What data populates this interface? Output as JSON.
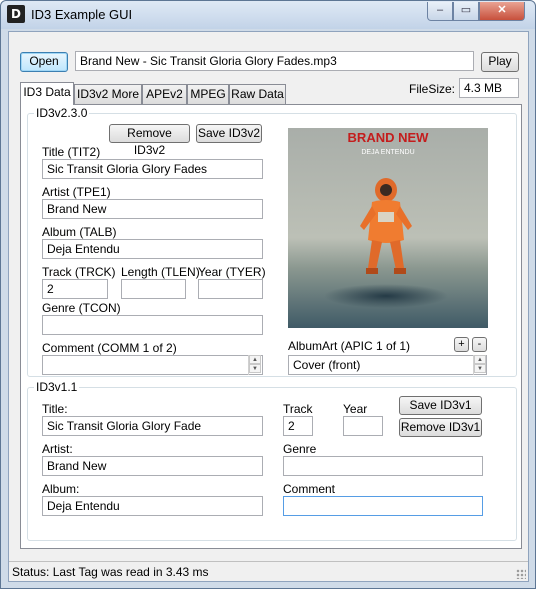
{
  "window": {
    "title": "ID3 Example GUI",
    "icon_text": "D",
    "controls": {
      "minimize": "‒",
      "maximize": "▭",
      "close": "✕"
    }
  },
  "toolbar": {
    "open_label": "Open",
    "file_path": "Brand New - Sic Transit Gloria  Glory Fades.mp3",
    "play_label": "Play",
    "filesize_label": "FileSize:",
    "filesize_value": "4.3 MB"
  },
  "tabs": [
    {
      "label": "ID3 Data"
    },
    {
      "label": "ID3v2 More"
    },
    {
      "label": "APEv2"
    },
    {
      "label": "MPEG"
    },
    {
      "label": "Raw Data"
    }
  ],
  "id3v2": {
    "legend": "ID3v2.3.0",
    "remove_label": "Remove ID3v2",
    "save_label": "Save ID3v2",
    "title_label": "Title (TIT2)",
    "title_value": "Sic Transit Gloria  Glory Fades",
    "artist_label": "Artist (TPE1)",
    "artist_value": "Brand New",
    "album_label": "Album (TALB)",
    "album_value": "Deja Entendu",
    "track_label": "Track (TRCK)",
    "track_value": "2",
    "length_label": "Length (TLEN)",
    "length_value": "",
    "year_label": "Year (TYER)",
    "year_value": "",
    "genre_label": "Genre (TCON)",
    "genre_value": "",
    "comment_label": "Comment (COMM 1 of 2)",
    "comment_value": "",
    "albumart_label": "AlbumArt (APIC 1 of 1)",
    "albumart_type": "Cover (front)",
    "add_pic": "+",
    "remove_pic": "-",
    "cover_band": "BRAND NEW",
    "cover_album": "DEJA ENTENDU"
  },
  "id3v1": {
    "legend": "ID3v1.1",
    "title_label": "Title:",
    "title_value": "Sic Transit Gloria  Glory Fade",
    "artist_label": "Artist:",
    "artist_value": "Brand New",
    "album_label": "Album:",
    "album_value": "Deja Entendu",
    "track_label": "Track",
    "track_value": "2",
    "year_label": "Year",
    "year_value": "",
    "genre_label": "Genre",
    "genre_value": "",
    "comment_label": "Comment",
    "comment_value": "",
    "save_label": "Save ID3v1",
    "remove_label": "Remove ID3v1"
  },
  "status": {
    "text": "Status: Last Tag was read in 3.43 ms"
  },
  "colors": {
    "window_frame": "#cfdbe8",
    "close_button": "#c7503c",
    "focus_border": "#569de5"
  }
}
